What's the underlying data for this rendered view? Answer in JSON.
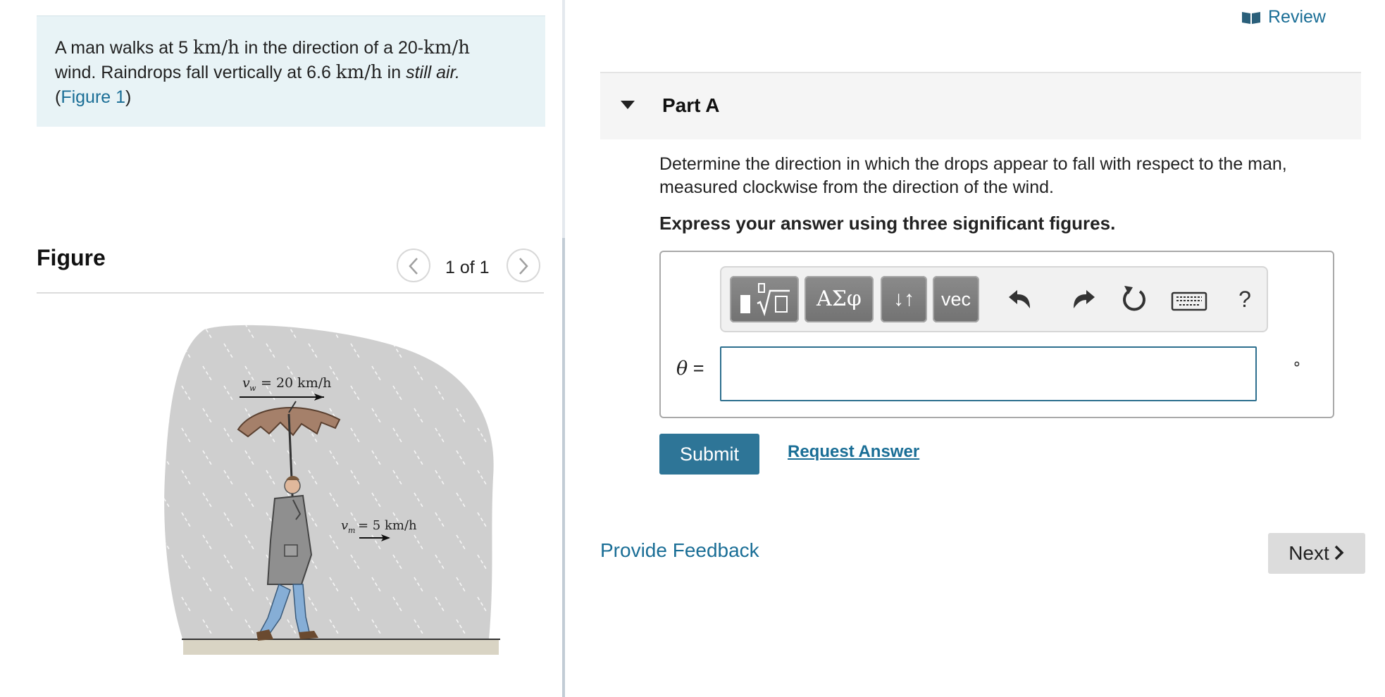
{
  "problem": {
    "text_a": "A man walks at 5 ",
    "unit_1": "km/h",
    "text_b": " in the direction of a 20-",
    "unit_2": "km/h",
    "text_c": " wind. Raindrops fall vertically at 6.6 ",
    "unit_3": "km/h",
    "text_d": " in ",
    "emphasis": "still air.",
    "paren_open": "(",
    "figure_link": "Figure 1",
    "paren_close": ")"
  },
  "figure": {
    "title": "Figure",
    "counter": "1 of 1",
    "prev_icon": "chevron-left-icon",
    "next_icon": "chevron-right-icon",
    "labels": {
      "wind_symbol": "v",
      "wind_sub": "w",
      "wind_value": "= 20 km/h",
      "man_symbol": "v",
      "man_sub": "m",
      "man_value": "= 5 km/h"
    }
  },
  "header": {
    "review_label": "Review",
    "review_icon": "book-icon"
  },
  "part": {
    "title": "Part A",
    "toggle_icon": "caret-down-icon",
    "question": "Determine the direction in which the drops appear to fall with respect to the man, measured clockwise from the direction of the wind.",
    "instruction": "Express your answer using three significant figures."
  },
  "toolbar": {
    "greek_label": "ΑΣφ",
    "arrows_label": "↓↑",
    "vec_label": "vec",
    "help_label": "?",
    "icons": [
      "templates-icon",
      "greek-letters-icon",
      "arrows-icon",
      "vector-icon",
      "undo-icon",
      "redo-icon",
      "reset-icon",
      "keyboard-icon",
      "help-icon"
    ]
  },
  "answer": {
    "variable": "θ",
    "equals": " =",
    "value": "",
    "unit": "∘"
  },
  "actions": {
    "submit_label": "Submit",
    "request_answer_label": "Request Answer",
    "feedback_label": "Provide Feedback",
    "next_label": "Next"
  },
  "colors": {
    "link": "#1a6e96",
    "submit_bg": "#2e7597",
    "problem_bg": "#e8f3f6"
  }
}
